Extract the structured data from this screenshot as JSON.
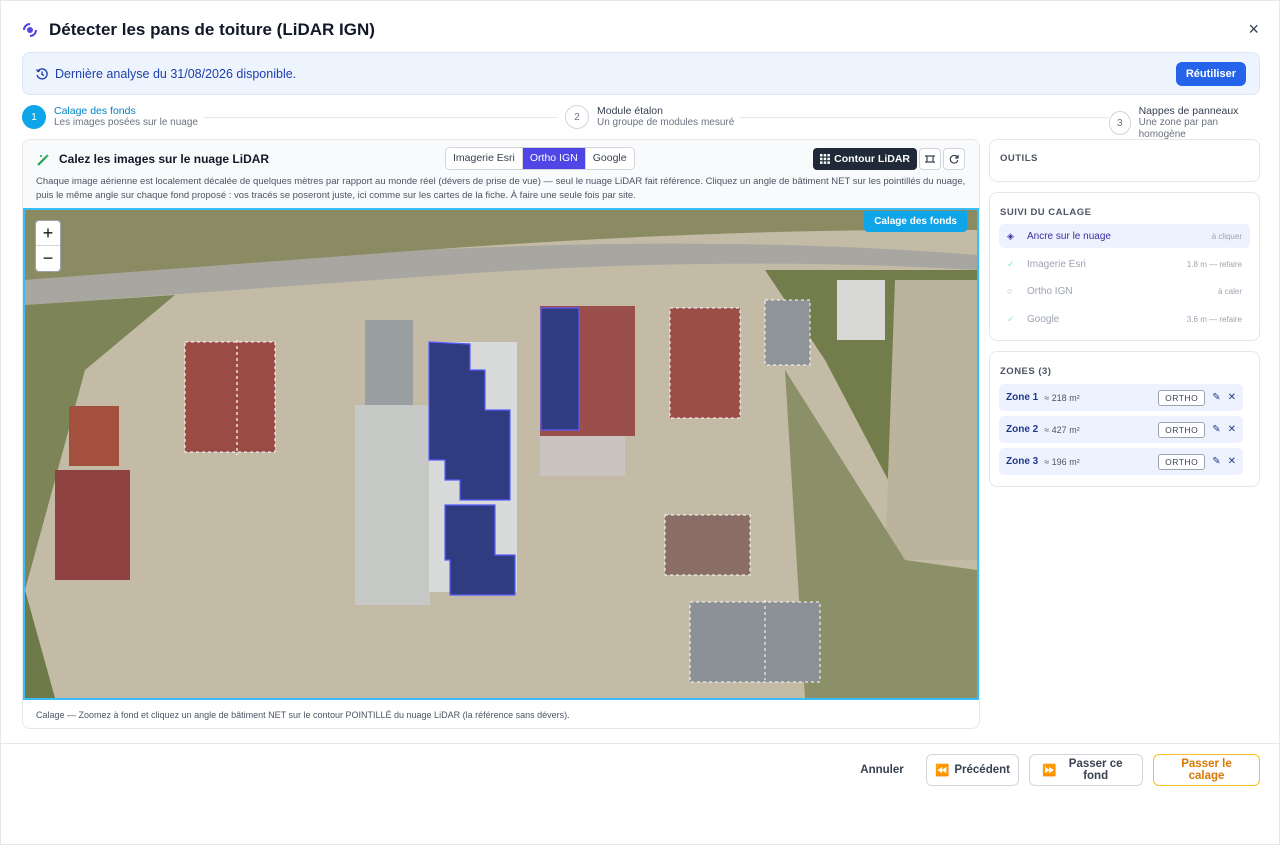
{
  "dialog": {
    "title": "Détecter les pans de toiture (LiDAR IGN)",
    "close_label": "×"
  },
  "banner": {
    "text": "Dernière analyse du 31/08/2026 disponible.",
    "reuse_label": "Réutiliser"
  },
  "steps": [
    {
      "num": "1",
      "title": "Calage des fonds",
      "subtitle": "Les images posées sur le nuage",
      "active": true
    },
    {
      "num": "2",
      "title": "Module étalon",
      "subtitle": "Un groupe de modules mesuré",
      "active": false
    },
    {
      "num": "3",
      "title": "Nappes de panneaux",
      "subtitle": "Une zone par pan homogène",
      "active": false
    }
  ],
  "card": {
    "title": "Calez les images sur le nuage LiDAR",
    "sources": [
      "Imagerie Esri",
      "Ortho IGN",
      "Google"
    ],
    "selected_source": "Ortho IGN",
    "contour_label": "Contour LiDAR",
    "description": "Chaque image aérienne est localement décalée de quelques mètres par rapport au monde réel (dévers de prise de vue) — seul le nuage LiDAR fait référence. Cliquez un angle de bâtiment NET sur les pointillés du nuage, puis le même angle sur chaque fond proposé : vos tracés se poseront juste, ici comme sur les cartes de la fiche. À faire une seule fois par site.",
    "map_badge": "Calage des fonds",
    "zoom_in": "+",
    "zoom_out": "−",
    "footer": "Calage — Zoomez à fond et cliquez un angle de bâtiment NET sur le contour POINTILLÉ du nuage LiDAR (la référence sans dévers)."
  },
  "tools_panel": {
    "title": "OUTILS"
  },
  "tracking": {
    "title": "SUIVI DU CALAGE",
    "items": [
      {
        "label": "Ancre sur le nuage",
        "status": "à cliquer",
        "icon": "target-icon"
      },
      {
        "label": "Imagerie Esri",
        "status": "1.8 m — refaire",
        "icon": "check-icon"
      },
      {
        "label": "Ortho IGN",
        "status": "à caler",
        "icon": "circle-icon"
      },
      {
        "label": "Google",
        "status": "3.6 m — refaire",
        "icon": "check-icon"
      }
    ]
  },
  "zones": {
    "title": "ZONES (3)",
    "items": [
      {
        "name": "Zone 1",
        "area": "≈ 218 m²",
        "source": "ORTHO"
      },
      {
        "name": "Zone 2",
        "area": "≈ 427 m²",
        "source": "ORTHO"
      },
      {
        "name": "Zone 3",
        "area": "≈ 196 m²",
        "source": "ORTHO"
      }
    ]
  },
  "footer": {
    "cancel": "Annuler",
    "previous": "Précédent",
    "skip": "Passer ce fond",
    "skip_calage": "Passer le calage"
  },
  "colors": {
    "accent": "#4f46e5",
    "step_active": "#0ea5e9",
    "primary_button": "#2563eb",
    "warn_button": "#d97706"
  }
}
